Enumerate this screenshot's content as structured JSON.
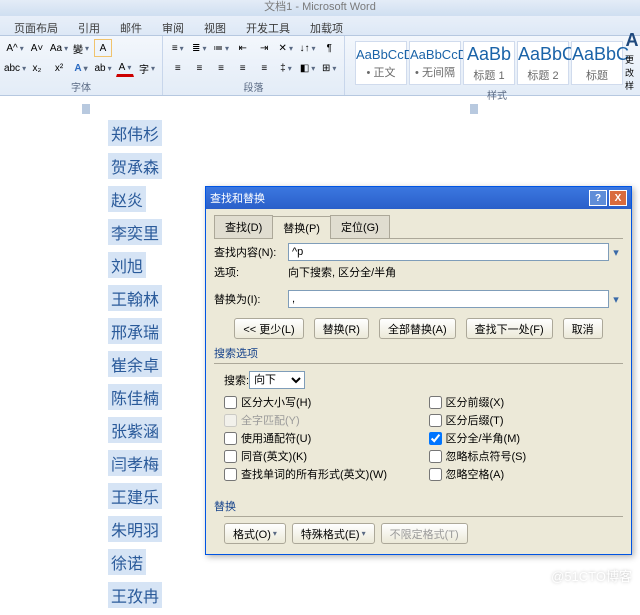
{
  "app": {
    "title": "文档1 - Microsoft Word"
  },
  "ribbon": {
    "tabs": [
      "页面布局",
      "引用",
      "邮件",
      "审阅",
      "视图",
      "开发工具",
      "加载项"
    ],
    "group_font": "字体",
    "group_para": "段落",
    "group_styles": "样式",
    "change_styles": "更改样",
    "styles": [
      {
        "prev": "AaBbCcDd",
        "name": "• 正文"
      },
      {
        "prev": "AaBbCcDd",
        "name": "• 无间隔"
      },
      {
        "prev": "AaBb",
        "name": "标题 1"
      },
      {
        "prev": "AaBbC",
        "name": "标题 2"
      },
      {
        "prev": "AaBbC",
        "name": "标题"
      }
    ]
  },
  "document": {
    "names": [
      "郑伟杉",
      "贺承森",
      "赵炎",
      "李奕里",
      "刘旭",
      "王翰林",
      "邢承瑞",
      "崔余卓",
      "陈佳楠",
      "张紫涵",
      "闫孝梅",
      "王建乐",
      "朱明羽",
      "徐诺",
      "王孜冉"
    ]
  },
  "dialog": {
    "title": "查找和替换",
    "tabs": {
      "find": "查找(D)",
      "replace": "替换(P)",
      "goto": "定位(G)"
    },
    "find_label": "查找内容(N):",
    "find_value": "^p",
    "options_label": "选项:",
    "options_value": "向下搜索, 区分全/半角",
    "replace_label": "替换为(I):",
    "replace_value": ",",
    "btn_less": "<< 更少(L)",
    "btn_replace": "替换(R)",
    "btn_replace_all": "全部替换(A)",
    "btn_find_next": "查找下一处(F)",
    "btn_cancel": "取消",
    "search_options_header": "搜索选项",
    "search_label": "搜索:",
    "search_dir": "向下",
    "opts_left": [
      {
        "label": "区分大小写(H)",
        "checked": false,
        "disabled": false
      },
      {
        "label": "全字匹配(Y)",
        "checked": false,
        "disabled": true
      },
      {
        "label": "使用通配符(U)",
        "checked": false,
        "disabled": false
      },
      {
        "label": "同音(英文)(K)",
        "checked": false,
        "disabled": false
      },
      {
        "label": "查找单词的所有形式(英文)(W)",
        "checked": false,
        "disabled": false
      }
    ],
    "opts_right": [
      {
        "label": "区分前缀(X)",
        "checked": false
      },
      {
        "label": "区分后缀(T)",
        "checked": false
      },
      {
        "label": "区分全/半角(M)",
        "checked": true
      },
      {
        "label": "忽略标点符号(S)",
        "checked": false
      },
      {
        "label": "忽略空格(A)",
        "checked": false
      }
    ],
    "replace_header": "替换",
    "btn_format": "格式(O)",
    "btn_special": "特殊格式(E)",
    "btn_noformat": "不限定格式(T)"
  },
  "watermark": "@51CTO博客"
}
